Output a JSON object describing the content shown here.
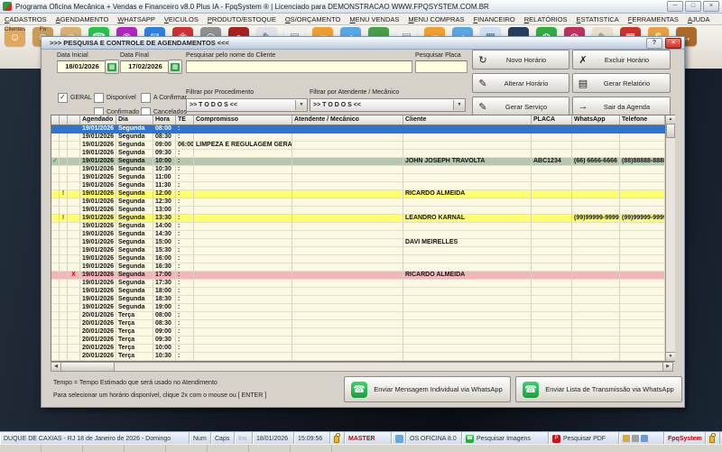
{
  "window": {
    "title": "Programa Oficina Mecânica + Vendas e Financeiro v8.0 Plus IA - FpqSystem ® | Licenciado para  DEMONSTRACAO WWW.FPQSYSTEM.COM.BR",
    "controls": {
      "minimize": "─",
      "maximize": "□",
      "close": "×"
    }
  },
  "menu": {
    "items": [
      "CADASTROS",
      "AGENDAMENTO",
      "WHATSAPP",
      "VEICULOS",
      "PRODUTO/ESTOQUE",
      "OS/ORÇAMENTO",
      "MENU VENDAS",
      "MENU COMPRAS",
      "FINANCEIRO",
      "RELATÓRIOS",
      "ESTATISTICA",
      "FERRAMENTAS",
      "AJUDA"
    ]
  },
  "toolbar": {
    "items": [
      {
        "name": "clientes-icon",
        "glyph": "☺",
        "bg": "#e0a85e",
        "label": "Clientes"
      },
      {
        "name": "fornecedores-icon",
        "glyph": "☺",
        "bg": "#c89c58",
        "label": "Fo"
      },
      {
        "name": "funcionarios-icon",
        "glyph": "☺",
        "bg": "#d8b070",
        "label": ""
      },
      {
        "name": "whatsapp-icon",
        "glyph": "☎",
        "bg": "#28c24a",
        "label": ""
      },
      {
        "name": "instagram-icon",
        "glyph": "◉",
        "bg": "#b226c0",
        "label": ""
      },
      {
        "name": "sms-icon",
        "glyph": "✉",
        "bg": "#2f7fe0",
        "label": ""
      },
      {
        "name": "frutas-icon",
        "glyph": "❀",
        "bg": "#d03030",
        "label": ""
      },
      {
        "name": "fipe-icon",
        "glyph": "◎",
        "bg": "#909090",
        "label": ""
      },
      {
        "name": "rodizio-icon",
        "glyph": "●",
        "bg": "#a82020",
        "label": ""
      },
      {
        "name": "os-clipboard-icon",
        "glyph": "✎",
        "bg": "#dfe3e9",
        "fg": "#555",
        "label": ""
      },
      {
        "name": "orcamento-doc-icon",
        "glyph": "▤",
        "bg": "#f0f0ee",
        "fg": "#888",
        "label": ""
      },
      {
        "name": "pasta-os-icon",
        "glyph": "▰",
        "bg": "#f0a030",
        "label": ""
      },
      {
        "name": "web-os-icon",
        "glyph": "◔",
        "bg": "#58a8e8",
        "label": ""
      },
      {
        "name": "vendas-balcao-icon",
        "glyph": "▬",
        "bg": "#48a048",
        "label": ""
      },
      {
        "name": "venda-doc-icon",
        "glyph": "▤",
        "bg": "#f0f0ee",
        "fg": "#888",
        "label": ""
      },
      {
        "name": "pasta-vendas-icon",
        "glyph": "▰",
        "bg": "#f0a030",
        "label": ""
      },
      {
        "name": "web-vendas-icon",
        "glyph": "◔",
        "bg": "#58a8e8",
        "label": ""
      },
      {
        "name": "estatistica-icon",
        "glyph": "▦",
        "bg": "#cfe0f0",
        "fg": "#3a6ea8",
        "label": ""
      },
      {
        "name": "carteira-icon",
        "glyph": "▬",
        "bg": "#274060",
        "label": ""
      },
      {
        "name": "receber-icon",
        "glyph": "◍",
        "bg": "#2fae3f",
        "label": ""
      },
      {
        "name": "pagar-icon",
        "glyph": "◍",
        "bg": "#c03060",
        "label": ""
      },
      {
        "name": "anotacoes-icon",
        "glyph": "✎",
        "bg": "#e8e0c8",
        "fg": "#777",
        "label": ""
      },
      {
        "name": "agenda-icon",
        "glyph": "▦",
        "bg": "#d03028",
        "label": ""
      },
      {
        "name": "caixa-icon",
        "glyph": "$",
        "bg": "#e8a040",
        "label": ""
      },
      {
        "name": "exit-door-icon",
        "glyph": "→",
        "bg": "#b06a28",
        "label": ""
      }
    ]
  },
  "glyphs": {
    "check": "✓",
    "down": "▼",
    "up": "▲",
    "left": "◀",
    "right": "▶",
    "help": "?",
    "close": "×",
    "calendar": "▦",
    "whatsapp": "☎"
  },
  "dialog": {
    "title": ">>>  PESQUISA E CONTROLE DE AGENDAMENTOS  <<<",
    "filters": {
      "data_inicial": {
        "label": "Data Inicial",
        "value": "18/01/2026"
      },
      "data_final": {
        "label": "Data Final",
        "value": "17/02/2026"
      },
      "cliente": {
        "label": "Pesquisar pelo nome do Cliente",
        "value": ""
      },
      "placa": {
        "label": "Pesquisar Placa",
        "value": ""
      },
      "checkboxes": [
        {
          "label": "GERAL",
          "checked": true
        },
        {
          "label": "Disponível",
          "checked": false
        },
        {
          "label": "A Confirmar",
          "checked": false
        },
        {
          "label": "Confirmado",
          "checked": false
        },
        {
          "label": "Cancelados",
          "checked": false
        }
      ],
      "procedimento": {
        "label": "Filtrar por Procedimento",
        "value": ">> T O D O S <<"
      },
      "atendente": {
        "label": "Filtrar por Atendente / Mecânico",
        "value": ">> T O D O S <<"
      }
    },
    "buttons": [
      {
        "label": "Novo Horário",
        "glyph": "↻",
        "color": "#1f9e3e"
      },
      {
        "label": "Excluir Horário",
        "glyph": "✗",
        "color": "#cc1111"
      },
      {
        "label": "Alterar Horário",
        "glyph": "✎",
        "color": "#b07010"
      },
      {
        "label": "Gerar Relatório",
        "glyph": "▤",
        "color": "#4a6a9a"
      },
      {
        "label": "Gerar  Serviço",
        "glyph": "✎",
        "color": "#666666"
      },
      {
        "label": "Sair da Agenda",
        "glyph": "→",
        "color": "#1a5ac8"
      }
    ],
    "table": {
      "headers": [
        "",
        "",
        "",
        "Agendado",
        "Dia",
        "Hora",
        "TE",
        "Compromisso",
        "Atendente / Mecânico",
        "Cliente",
        "PLACA",
        "WhatsApp",
        "Telefone"
      ],
      "rows": [
        {
          "date": "19/01/2026",
          "day": "Segunda",
          "hora": "08:00",
          "te": ":",
          "state": "selected"
        },
        {
          "date": "19/01/2026",
          "day": "Segunda",
          "hora": "08:30",
          "te": ":"
        },
        {
          "date": "19/01/2026",
          "day": "Segunda",
          "hora": "09:00",
          "te": "06:00",
          "comp": "LIMPEZA E REGULAGEM GERAL"
        },
        {
          "date": "19/01/2026",
          "day": "Segunda",
          "hora": "09:30",
          "te": ":"
        },
        {
          "m1": "✓",
          "date": "19/01/2026",
          "day": "Segunda",
          "hora": "10:00",
          "te": ":",
          "cliente": "JOHN JOSEPH TRAVOLTA",
          "placa": "ABC1234",
          "wa": "(66) 6666-6666",
          "tel": "(88)88888-8888",
          "state": "confirmed"
        },
        {
          "date": "19/01/2026",
          "day": "Segunda",
          "hora": "10:30",
          "te": ":"
        },
        {
          "date": "19/01/2026",
          "day": "Segunda",
          "hora": "11:00",
          "te": ":"
        },
        {
          "date": "19/01/2026",
          "day": "Segunda",
          "hora": "11:30",
          "te": ":"
        },
        {
          "m2": "!",
          "date": "19/01/2026",
          "day": "Segunda",
          "hora": "12:00",
          "te": ":",
          "cliente": "RICARDO ALMEIDA",
          "state": "warn"
        },
        {
          "date": "19/01/2026",
          "day": "Segunda",
          "hora": "12:30",
          "te": ":"
        },
        {
          "date": "19/01/2026",
          "day": "Segunda",
          "hora": "13:00",
          "te": ":"
        },
        {
          "m2": "!",
          "date": "19/01/2026",
          "day": "Segunda",
          "hora": "13:30",
          "te": ":",
          "cliente": "LEANDRO KARNAL",
          "wa": "(99)99999-9999",
          "tel": "(99)99999-9999",
          "state": "warn"
        },
        {
          "date": "19/01/2026",
          "day": "Segunda",
          "hora": "14:00",
          "te": ":"
        },
        {
          "date": "19/01/2026",
          "day": "Segunda",
          "hora": "14:30",
          "te": ":"
        },
        {
          "date": "19/01/2026",
          "day": "Segunda",
          "hora": "15:00",
          "te": ":",
          "cliente": "DAVI MEIRELLES"
        },
        {
          "date": "19/01/2026",
          "day": "Segunda",
          "hora": "15:30",
          "te": ":"
        },
        {
          "date": "19/01/2026",
          "day": "Segunda",
          "hora": "16:00",
          "te": ":"
        },
        {
          "date": "19/01/2026",
          "day": "Segunda",
          "hora": "16:30",
          "te": ":"
        },
        {
          "m3": "X",
          "date": "19/01/2026",
          "day": "Segunda",
          "hora": "17:00",
          "te": ":",
          "cliente": "RICARDO ALMEIDA",
          "state": "cancel"
        },
        {
          "date": "19/01/2026",
          "day": "Segunda",
          "hora": "17:30",
          "te": ":"
        },
        {
          "date": "19/01/2026",
          "day": "Segunda",
          "hora": "18:00",
          "te": ":"
        },
        {
          "date": "19/01/2026",
          "day": "Segunda",
          "hora": "18:30",
          "te": ":"
        },
        {
          "date": "19/01/2026",
          "day": "Segunda",
          "hora": "19:00",
          "te": ":"
        },
        {
          "date": "20/01/2026",
          "day": "Terça",
          "hora": "08:00",
          "te": ":"
        },
        {
          "date": "20/01/2026",
          "day": "Terça",
          "hora": "08:30",
          "te": ":"
        },
        {
          "date": "20/01/2026",
          "day": "Terça",
          "hora": "09:00",
          "te": ":"
        },
        {
          "date": "20/01/2026",
          "day": "Terça",
          "hora": "09:30",
          "te": ":"
        },
        {
          "date": "20/01/2026",
          "day": "Terça",
          "hora": "10:00",
          "te": ":"
        },
        {
          "date": "20/01/2026",
          "day": "Terça",
          "hora": "10:30",
          "te": ":"
        }
      ]
    },
    "notes": [
      "Tempo = Tempo Estimado que será usado no Atendimento",
      "Para selecionar um horário disponível, clique 2x com o mouse ou [ ENTER ]"
    ],
    "whatsapp_buttons": [
      "Enviar Mensagem Individual via WhatsApp",
      "Enviar Lista de Transmissão via WhatsApp"
    ]
  },
  "statusbar": {
    "cells": [
      {
        "name": "location",
        "text": "DUQUE DE CAXIAS - RJ 18 de Janeiro de 2026 - Domingo"
      },
      {
        "name": "num",
        "text": "Num"
      },
      {
        "name": "caps",
        "text": "Caps"
      },
      {
        "name": "ins",
        "text": "Ins",
        "muted": true
      },
      {
        "name": "current-date",
        "text": "18/01/2026"
      },
      {
        "name": "current-time",
        "text": "15:09:56"
      },
      {
        "name": "lock-cell",
        "text": "",
        "icon": "lock"
      },
      {
        "name": "user",
        "text": "MASTER",
        "color": "#cc0000"
      },
      {
        "name": "app-icon-cell",
        "text": "",
        "icon": "app"
      },
      {
        "name": "app-version",
        "text": "OS OFICINA 8.0"
      },
      {
        "name": "pesquisar-imagens",
        "text": "Pesquisar Imagens",
        "icon": "wa",
        "interactable": true
      },
      {
        "name": "pesquisar-pdf",
        "text": "Pesquisar PDF",
        "icon": "pdf",
        "interactable": true
      },
      {
        "name": "tools-cell",
        "text": "",
        "icon": "tools"
      },
      {
        "name": "brand",
        "text": "FpqSystem",
        "color": "#cc0000"
      },
      {
        "name": "lock-cell-2",
        "text": "",
        "icon": "lock"
      }
    ]
  },
  "colors": {
    "selected_row": "#2e74d4",
    "confirmed_row": "#b5c7b0",
    "warning_row": "#ffff6e",
    "cancelled_row": "#f2b6ba",
    "row_bg": "#fbf8e3",
    "input_bg": "#ffffdf",
    "whatsapp_green": "#25b03c",
    "alert_red": "#cc0000"
  }
}
